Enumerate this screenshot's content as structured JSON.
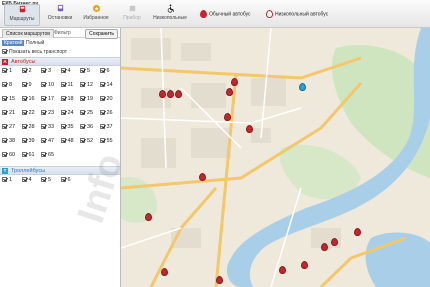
{
  "app": {
    "logo_text": "ЕКБ Бизнес.ру"
  },
  "toolbar": {
    "routes": "Маршруты",
    "stops": "Остановки",
    "favorites": "Избранное",
    "devices": "Прибор",
    "lowfloor": "Низкопольные"
  },
  "legend": {
    "regular": "Обычный автобус",
    "lowfloor": "Низкопольный автобус"
  },
  "sidebar": {
    "tab_list": "Список маршрутов",
    "tab_filter": "Фильтр",
    "save": "Сохранить",
    "mode_short": "Краткий",
    "mode_full": "Полный",
    "show_all": "Показать весь транспорт",
    "bus_title": "Автобусы",
    "bus_badge": "А",
    "bus_routes": [
      "1",
      "2",
      "3",
      "4",
      "5",
      "6",
      "8",
      "9",
      "10",
      "11",
      "12",
      "14",
      "15",
      "16",
      "17",
      "18",
      "19",
      "20",
      "21",
      "22",
      "23",
      "24",
      "25",
      "26",
      "27",
      "28",
      "33",
      "35",
      "36",
      "37",
      "38",
      "39",
      "47",
      "48",
      "52",
      "55",
      "60",
      "61",
      "65"
    ],
    "trol_title": "Троллейбусы",
    "trol_badge": "Т",
    "trol_routes": [
      "1",
      "4",
      "5",
      "6"
    ]
  },
  "colors": {
    "bus": "#c4262e",
    "trolley": "#27a0d8",
    "accent": "#5a87c5"
  },
  "watermark": "Info"
}
